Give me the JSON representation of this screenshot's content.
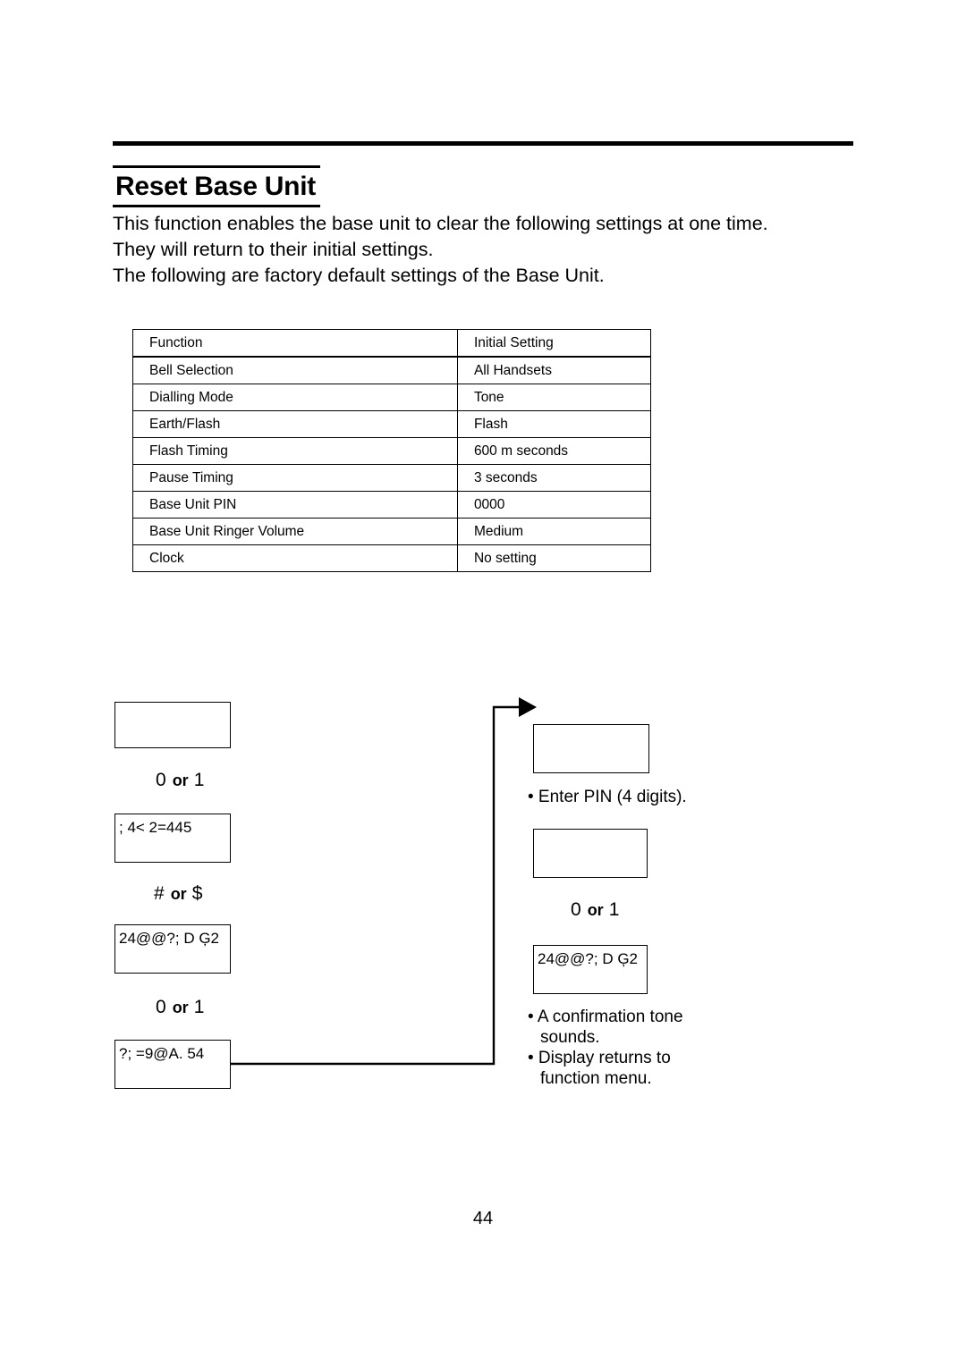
{
  "document": {
    "page_number": "44",
    "heading": "Reset Base Unit",
    "intro_lines": [
      "This function enables the base unit to clear the following settings at one time.",
      "They will return to their initial settings.",
      "The following are factory default settings of the Base Unit."
    ]
  },
  "table": {
    "headers": [
      "Function",
      "Initial Setting"
    ],
    "rows": [
      [
        "Bell Selection",
        "All Handsets"
      ],
      [
        "Dialling Mode",
        "Tone"
      ],
      [
        "Earth/Flash",
        "Flash"
      ],
      [
        "Flash Timing",
        "600 m seconds"
      ],
      [
        "Pause Timing",
        "3 seconds"
      ],
      [
        "Base Unit PIN",
        "0000"
      ],
      [
        "Base Unit Ringer Volume",
        "Medium"
      ],
      [
        "Clock",
        "No setting"
      ]
    ]
  },
  "flow": {
    "left": {
      "screen_1": "",
      "key_1": {
        "first": "0",
        "or": "or",
        "second": "1"
      },
      "screen_2": "; 4< 2=445",
      "key_2": {
        "first": "#",
        "or": "or",
        "second": "$"
      },
      "screen_3": "24@@?; D Ģ2",
      "key_3": {
        "first": "0",
        "or": "or",
        "second": "1"
      },
      "screen_4": "?; =9@A. 54"
    },
    "right": {
      "screen_1": "",
      "note_1": "• Enter PIN (4 digits).",
      "screen_2": "",
      "key_1": {
        "first": "0",
        "or": "or",
        "second": "1"
      },
      "screen_3": "24@@?; D Ģ2",
      "note_2_line1": "• A confirmation tone",
      "note_2_line2": "sounds.",
      "note_2_line3": "• Display returns to",
      "note_2_line4": "function menu."
    }
  }
}
